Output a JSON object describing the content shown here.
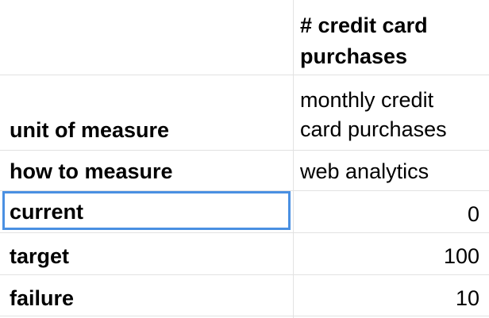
{
  "sheet": {
    "header": {
      "line1": "# credit card",
      "line2": "purchases"
    },
    "rows": [
      {
        "label": "unit of measure",
        "value_line1": "monthly credit",
        "value_line2": "card purchases"
      },
      {
        "label": "how to measure",
        "value": "web analytics"
      },
      {
        "label": "current",
        "value": "0"
      },
      {
        "label": "target",
        "value": "100"
      },
      {
        "label": "failure",
        "value": "10"
      }
    ],
    "selected_cell": "current",
    "selection_color": "#4a90e2",
    "gridline_color": "#e2e2e2"
  }
}
